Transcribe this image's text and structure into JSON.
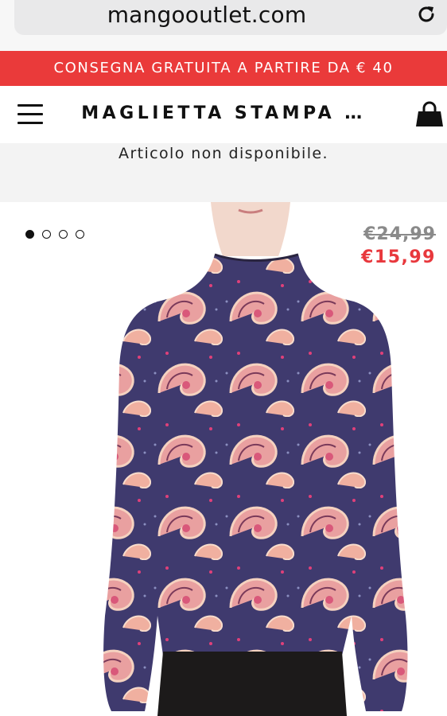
{
  "browser": {
    "url": "mangooutlet.com",
    "reload_icon": "reload-icon"
  },
  "promo": {
    "text": "CONSEGNA GRATUITA A PARTIRE DA € 40",
    "color": "#ea3a3a"
  },
  "header": {
    "menu_icon": "hamburger-menu-icon",
    "title": "MAGLIETTA STAMPA …",
    "bag_icon": "shopping-bag-icon"
  },
  "notice": {
    "text": "Articolo non disponibile."
  },
  "product": {
    "carousel": {
      "total": 4,
      "active_index": 0
    },
    "price_old": "€24,99",
    "price_new": "€15,99",
    "sale_color": "#e8383d",
    "image": "paisley print mock-neck long-sleeve top"
  }
}
